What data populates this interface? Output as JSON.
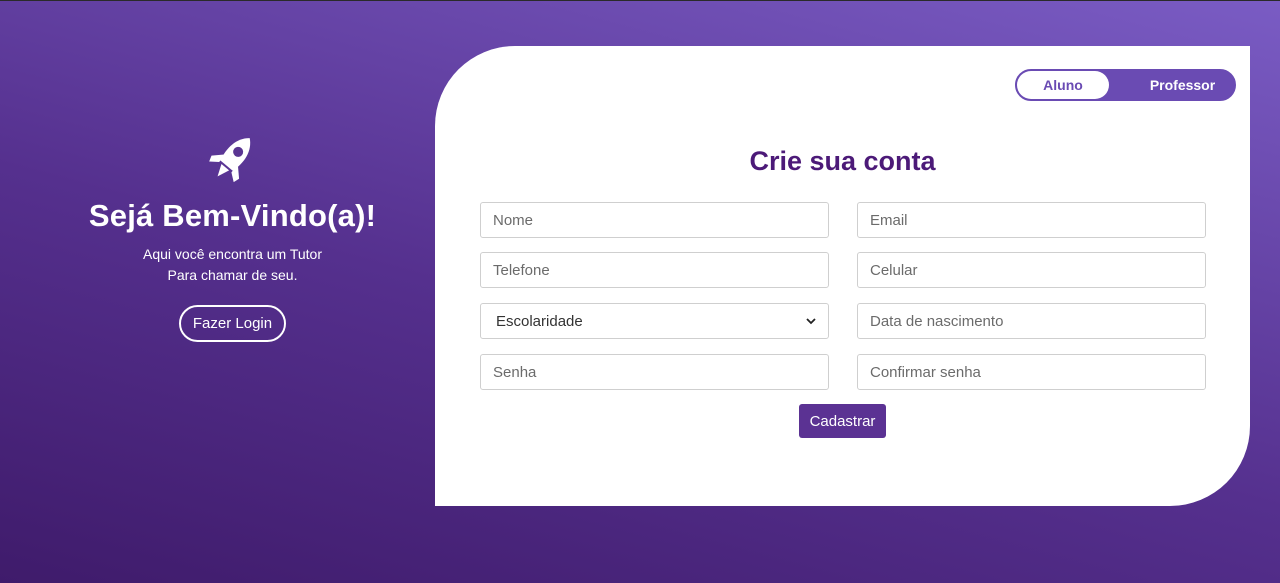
{
  "welcome": {
    "icon": "rocket-icon",
    "title": "Sejá Bem-Vindo(a)!",
    "subtitle_line1": "Aqui você encontra um Tutor",
    "subtitle_line2": "Para chamar de seu.",
    "login_label": "Fazer Login"
  },
  "toggle": {
    "option_student": "Aluno",
    "option_teacher": "Professor",
    "selected": "Aluno"
  },
  "form": {
    "title": "Crie sua conta",
    "name_placeholder": "Nome",
    "email_placeholder": "Email",
    "phone_placeholder": "Telefone",
    "cell_placeholder": "Celular",
    "education_selected": "Escolaridade",
    "birthdate_placeholder": "Data de nascimento",
    "password_placeholder": "Senha",
    "confirm_password_placeholder": "Confirmar senha",
    "submit_label": "Cadastrar"
  },
  "colors": {
    "accent": "#5b3293",
    "title": "#4c1a78",
    "toggle": "#6a4bb3"
  }
}
